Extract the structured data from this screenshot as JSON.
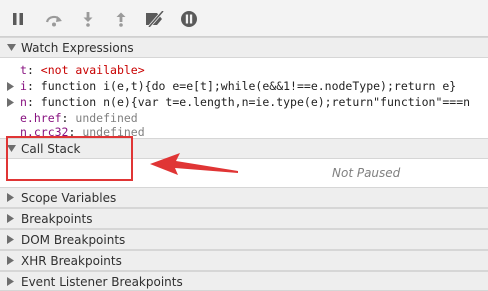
{
  "toolbar": {
    "buttons": [
      {
        "icon": "pause-icon"
      },
      {
        "icon": "step-over-icon"
      },
      {
        "icon": "step-into-icon"
      },
      {
        "icon": "step-out-icon"
      },
      {
        "icon": "deactivate-breakpoints-icon"
      },
      {
        "icon": "pause-on-exceptions-icon"
      }
    ]
  },
  "watch": {
    "title": "Watch Expressions",
    "items": [
      {
        "name": "t",
        "value": "<not available>"
      },
      {
        "name": "i",
        "value": "function i(e,t){do e=e[t];while(e&&1!==e.nodeType);return e}"
      },
      {
        "name": "n",
        "value": "function n(e){var t=e.length,n=ie.type(e);return\"function\"===n"
      },
      {
        "name": "e.href",
        "value": "undefined"
      },
      {
        "name": "n.crc32",
        "value": "undefined"
      }
    ]
  },
  "call_stack": {
    "title": "Call Stack",
    "status": "Not Paused"
  },
  "sections": [
    {
      "title": "Scope Variables"
    },
    {
      "title": "Breakpoints"
    },
    {
      "title": "DOM Breakpoints"
    },
    {
      "title": "XHR Breakpoints"
    },
    {
      "title": "Event Listener Breakpoints"
    }
  ],
  "colors": {
    "annotation": "#e03535",
    "property_name": "#881280",
    "not_available": "#c80000"
  }
}
